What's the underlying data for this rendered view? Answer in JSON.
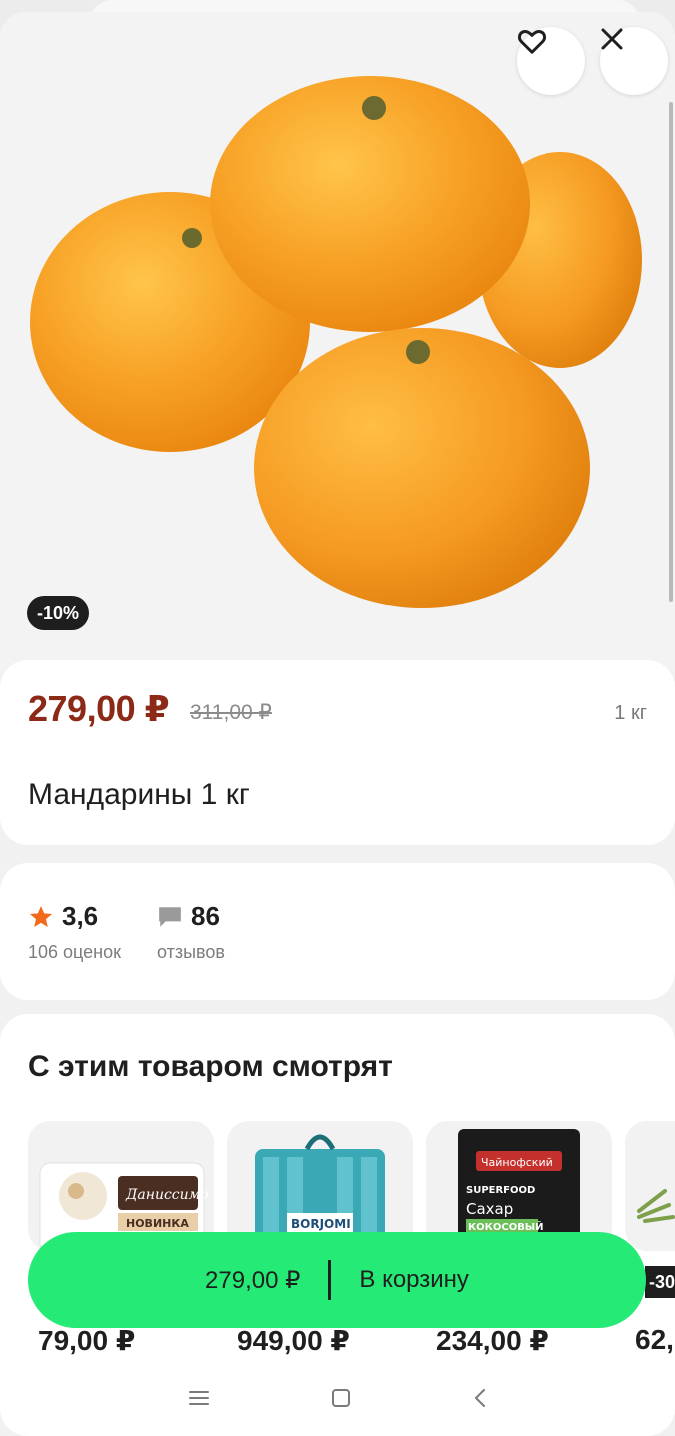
{
  "product": {
    "discount_badge": "-10%",
    "price_current": "279,00 ₽",
    "price_old": "311,00 ₽",
    "weight": "1 кг",
    "title": "Мандарины 1 кг"
  },
  "rating": {
    "score": "3,6",
    "ratings_count_label": "106 оценок",
    "reviews_count": "86",
    "reviews_label": "отзывов"
  },
  "recommendations": {
    "title": "С этим товаром смотрят",
    "items": [
      {
        "price": "79,00 ₽",
        "brand": "Даниссимо",
        "tag": "НОВИНКА"
      },
      {
        "price": "949,00 ₽",
        "brand": "BORJOMI"
      },
      {
        "price": "234,00 ₽",
        "brand": "Чайнофский",
        "line1": "SUPERFOOD",
        "line2": "Сахар",
        "line3": "КОКОСОВЫЙ"
      },
      {
        "price": "62,",
        "badge": "-30"
      }
    ]
  },
  "cart_button": {
    "price": "279,00 ₽",
    "label": "В корзину"
  },
  "colors": {
    "accent_green": "#26ea76",
    "price_red": "#8c2a17",
    "star_orange": "#f26a1b"
  },
  "icons": [
    "heart-icon",
    "close-icon",
    "star-icon",
    "comment-icon",
    "menu-icon",
    "home-square-icon",
    "back-chevron-icon"
  ]
}
